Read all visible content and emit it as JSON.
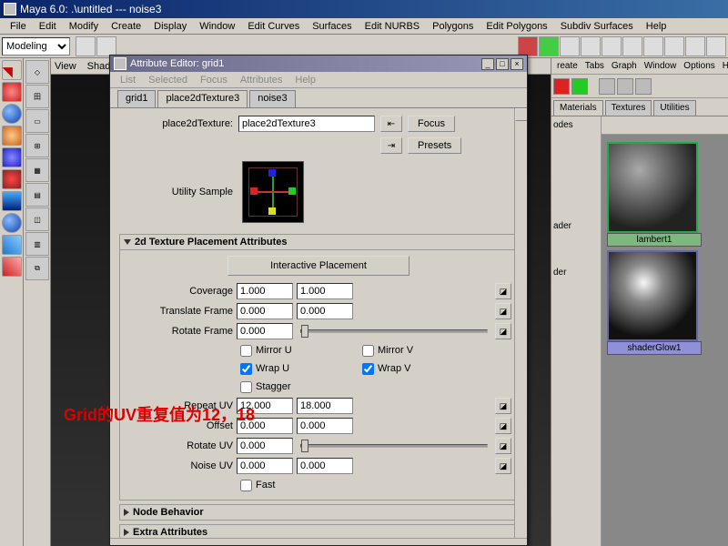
{
  "titlebar": {
    "text": "Maya 6.0: .\\untitled   ---   noise3"
  },
  "menubar": {
    "items": [
      "File",
      "Edit",
      "Modify",
      "Create",
      "Display",
      "Window",
      "Edit Curves",
      "Surfaces",
      "Edit NURBS",
      "Polygons",
      "Edit Polygons",
      "Subdiv Surfaces",
      "Help"
    ]
  },
  "shelf": {
    "mode": "Modeling"
  },
  "view_menu": {
    "items": [
      "View",
      "Shading"
    ]
  },
  "right_panel": {
    "menubar": [
      "reate",
      "Tabs",
      "Graph",
      "Window",
      "Options",
      "He"
    ],
    "tabs": [
      "Materials",
      "Textures",
      "Utilities"
    ],
    "side_items": [
      "odes",
      "ader",
      "der"
    ],
    "swatches": [
      {
        "label": "lambert1"
      },
      {
        "label": "shaderGlow1"
      }
    ]
  },
  "ae": {
    "title": "Attribute Editor: grid1",
    "menu": [
      "List",
      "Selected",
      "Focus",
      "Attributes",
      "Help"
    ],
    "tabs": [
      "grid1",
      "place2dTexture3",
      "noise3"
    ],
    "active_tab": 1,
    "node_label": "place2dTexture:",
    "node_name": "place2dTexture3",
    "focus_btn": "Focus",
    "presets_btn": "Presets",
    "utility_label": "Utility Sample",
    "section_main": {
      "title": "2d Texture Placement Attributes",
      "interactive_btn": "Interactive Placement",
      "coverage": {
        "label": "Coverage",
        "u": "1.000",
        "v": "1.000"
      },
      "translate": {
        "label": "Translate Frame",
        "u": "0.000",
        "v": "0.000"
      },
      "rotate_frame": {
        "label": "Rotate Frame",
        "val": "0.000"
      },
      "mirror_u": {
        "label": "Mirror U",
        "checked": false
      },
      "mirror_v": {
        "label": "Mirror V",
        "checked": false
      },
      "wrap_u": {
        "label": "Wrap U",
        "checked": true
      },
      "wrap_v": {
        "label": "Wrap V",
        "checked": true
      },
      "stagger": {
        "label": "Stagger",
        "checked": false
      },
      "repeat": {
        "label": "Repeat UV",
        "u": "12.000",
        "v": "18.000"
      },
      "offset": {
        "label": "Offset",
        "u": "0.000",
        "v": "0.000"
      },
      "rotate_uv": {
        "label": "Rotate UV",
        "val": "0.000"
      },
      "noise": {
        "label": "Noise UV",
        "u": "0.000",
        "v": "0.000"
      },
      "fast": {
        "label": "Fast",
        "checked": false
      }
    },
    "section_node": {
      "title": "Node Behavior"
    },
    "section_extra": {
      "title": "Extra Attributes"
    }
  },
  "annotation": "Grid的UV重复值为12，18"
}
